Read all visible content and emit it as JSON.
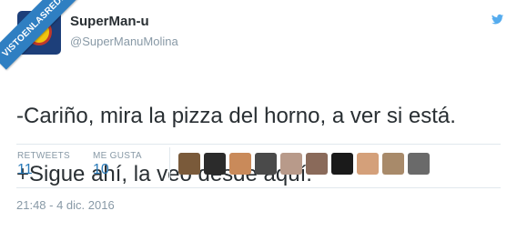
{
  "watermark": {
    "text": "VISTOENLASREDES"
  },
  "author": {
    "display_name": "SuperMan-u",
    "handle": "@SuperManuMolina"
  },
  "tweet": {
    "text_line1": "-Cariño, mira la pizza del horno, a ver si está.",
    "text_line2": "+Sigue ahí, la veo desde aquí."
  },
  "stats": {
    "retweets_label": "RETWEETS",
    "retweets_value": "11",
    "likes_label": "ME GUSTA",
    "likes_value": "10"
  },
  "likers": [
    {
      "color": "#7a5a3a"
    },
    {
      "color": "#2b2b2b"
    },
    {
      "color": "#c98a5a"
    },
    {
      "color": "#4a4a4a"
    },
    {
      "color": "#b89a8a"
    },
    {
      "color": "#8a6a5a"
    },
    {
      "color": "#1a1a1a"
    },
    {
      "color": "#d4a07a"
    },
    {
      "color": "#a88a6a"
    },
    {
      "color": "#6a6a6a"
    }
  ],
  "timestamp": "21:48 - 4 dic. 2016",
  "colors": {
    "link_blue": "#2b7bb9",
    "muted_gray": "#8899a6",
    "text_dark": "#292f33",
    "watermark_blue": "#2f7fc2"
  }
}
